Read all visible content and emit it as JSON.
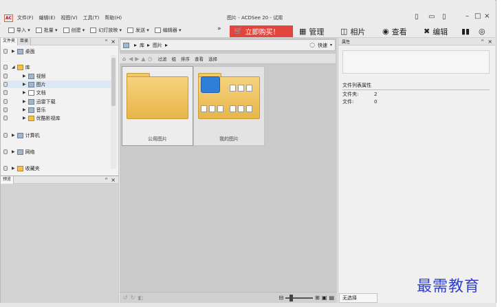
{
  "app": {
    "title": "图片 - ACDSee 20 - 试用",
    "logo": "AC"
  },
  "menu": [
    "文件(F)",
    "编辑(E)",
    "视图(V)",
    "工具(T)",
    "帮助(H)"
  ],
  "toolbar": {
    "import": "导入",
    "batch": "批量",
    "create": "创建",
    "slideshow": "幻灯放映",
    "send": "发送",
    "editor": "编辑器",
    "more": "»",
    "buy": "立即购买！",
    "modes": [
      "管理",
      "相片",
      "查看",
      "编辑"
    ]
  },
  "left_panel": {
    "tabs": [
      "文件夹",
      "目录"
    ],
    "tree": {
      "desktop": "桌面",
      "library": "库",
      "videos": "视频",
      "pictures": "图片",
      "documents": "文档",
      "xunlei": "迅雷下载",
      "music": "音乐",
      "youku": "优酷影视库",
      "computer": "计算机",
      "network": "网络",
      "favorites": "收藏夹"
    }
  },
  "preview_panel": {
    "title": "预览"
  },
  "center": {
    "path": [
      "库",
      "图片"
    ],
    "quick_label": "快速",
    "filters": [
      "过滤",
      "组",
      "排序",
      "查看",
      "选择"
    ],
    "items": [
      {
        "label": "公用图片"
      },
      {
        "label": "我的图片"
      }
    ]
  },
  "right_panel": {
    "title": "属性",
    "section": "文件列表属性",
    "folders_label": "文件夹:",
    "folders_value": "2",
    "files_label": "文件:",
    "files_value": "0",
    "bottom_tab": "无选择"
  },
  "watermark": "最需教育",
  "colors": {
    "buy": "#e2453d",
    "watermark": "#2f3fd0"
  }
}
